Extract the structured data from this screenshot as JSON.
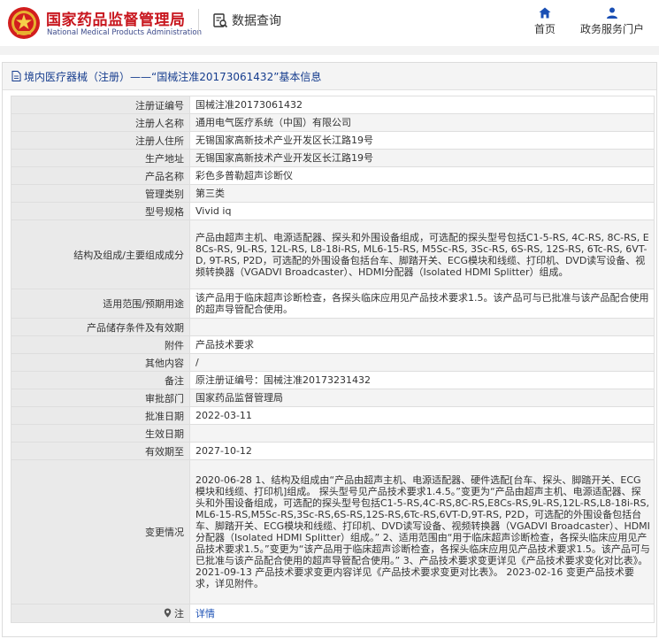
{
  "header": {
    "org_name_cn": "国家药品监督管理局",
    "org_name_en": "National Medical Products Administration",
    "search_title": "数据查询",
    "nav": [
      {
        "label": "首页",
        "icon": "home-icon"
      },
      {
        "label": "政务服务门户",
        "icon": "user-group-icon"
      }
    ]
  },
  "panel": {
    "title": "境内医疗器械（注册）——“国械注准20173061432”基本信息"
  },
  "rows": [
    {
      "label": "注册证编号",
      "value": "国械注准20173061432"
    },
    {
      "label": "注册人名称",
      "value": "通用电气医疗系统（中国）有限公司"
    },
    {
      "label": "注册人住所",
      "value": "无锡国家高新技术产业开发区长江路19号"
    },
    {
      "label": "生产地址",
      "value": "无锡国家高新技术产业开发区长江路19号"
    },
    {
      "label": "产品名称",
      "value": "彩色多普勒超声诊断仪"
    },
    {
      "label": "管理类别",
      "value": "第三类"
    },
    {
      "label": "型号规格",
      "value": "Vivid iq"
    },
    {
      "label": "结构及组成/主要组成成分",
      "value": "产品由超声主机、电源适配器、探头和外围设备组成，可选配的探头型号包括C1-5-RS, 4C-RS, 8C-RS, E8Cs-RS, 9L-RS, 12L-RS, L8-18i-RS, ML6-15-RS, M5Sc-RS, 3Sc-RS, 6S-RS, 12S-RS, 6Tc-RS, 6VT-D, 9T-RS, P2D，可选配的外围设备包括台车、脚踏开关、ECG模块和线缆、打印机、DVD读写设备、视频转换器（VGADVI Broadcaster）、HDMI分配器（Isolated HDMI Splitter）组成。"
    },
    {
      "label": "适用范围/预期用途",
      "value": "该产品用于临床超声诊断检查，各探头临床应用见产品技术要求1.5。该产品可与已批准与该产品配合使用的超声导管配合使用。"
    },
    {
      "label": "产品储存条件及有效期",
      "value": ""
    },
    {
      "label": "附件",
      "value": "产品技术要求"
    },
    {
      "label": "其他内容",
      "value": "/"
    },
    {
      "label": "备注",
      "value": "原注册证编号：国械注准20173231432"
    },
    {
      "label": "审批部门",
      "value": "国家药品监督管理局"
    },
    {
      "label": "批准日期",
      "value": "2022-03-11"
    },
    {
      "label": "生效日期",
      "value": ""
    },
    {
      "label": "有效期至",
      "value": "2027-10-12"
    },
    {
      "label": "变更情况",
      "value": "2020-06-28 1、结构及组成由“产品由超声主机、电源适配器、硬件选配[台车、探头、脚踏开关、ECG模块和线缆、打印机]组成。 探头型号见产品技术要求1.4.5。”变更为“产品由超声主机、电源适配器、探头和外围设备组成，可选配的探头型号包括C1-5-RS,4C-RS,8C-RS,E8Cs-RS,9L-RS,12L-RS,L8-18i-RS,ML6-15-RS,M5Sc-RS,3Sc-RS,6S-RS,12S-RS,6Tc-RS,6VT-D,9T-RS, P2D，可选配的外围设备包括台车、脚踏开关、ECG模块和线缆、打印机、DVD读写设备、视频转换器（VGADVI Broadcaster）、HDMI分配器（Isolated HDMI Splitter）组成。” 2、适用范围由“用于临床超声诊断检查，各探头临床应用见产品技术要求1.5。”变更为“该产品用于临床超声诊断检查，各探头临床应用见产品技术要求1.5。该产品可与已批准与该产品配合使用的超声导管配合使用。” 3、产品技术要求变更详见《产品技术要求变化对比表》。 2021-09-13 产品技术要求变更内容详见《产品技术要求变更对比表》。 2023-02-16 变更产品技术要求，详见附件。"
    }
  ],
  "note_row": {
    "label": "注",
    "icon": "location-pin-icon",
    "link": "详情"
  }
}
